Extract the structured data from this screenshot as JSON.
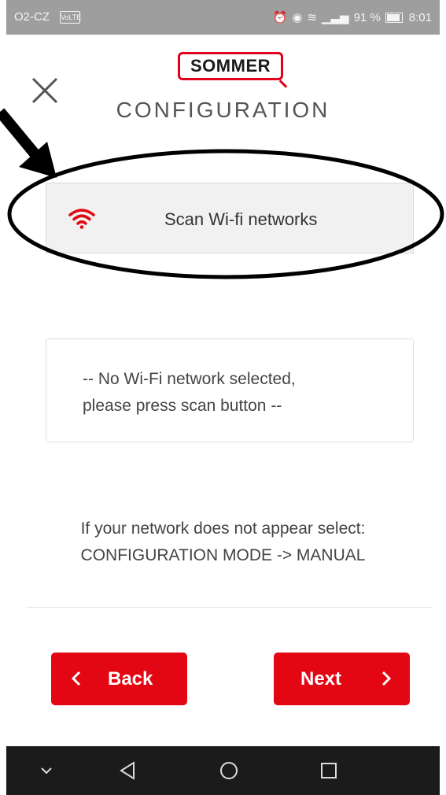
{
  "status_bar": {
    "carrier": "O2-CZ",
    "volte": "VoLTE",
    "battery": "91 %",
    "time": "8:01"
  },
  "header": {
    "brand": "SOMMER",
    "title": "CONFIGURATION"
  },
  "scan_button": {
    "label": "Scan Wi-fi networks",
    "icon": "wifi-icon"
  },
  "selected_network": {
    "line1": "-- No Wi-Fi network selected,",
    "line2": "please press scan button --"
  },
  "help": {
    "line1": "If your network does not appear select:",
    "line2": "CONFIGURATION MODE -> MANUAL"
  },
  "buttons": {
    "back": "Back",
    "next": "Next"
  },
  "colors": {
    "accent": "#e30613",
    "status_bar": "#9e9e9e",
    "nav_bar": "#1b1b1b"
  }
}
